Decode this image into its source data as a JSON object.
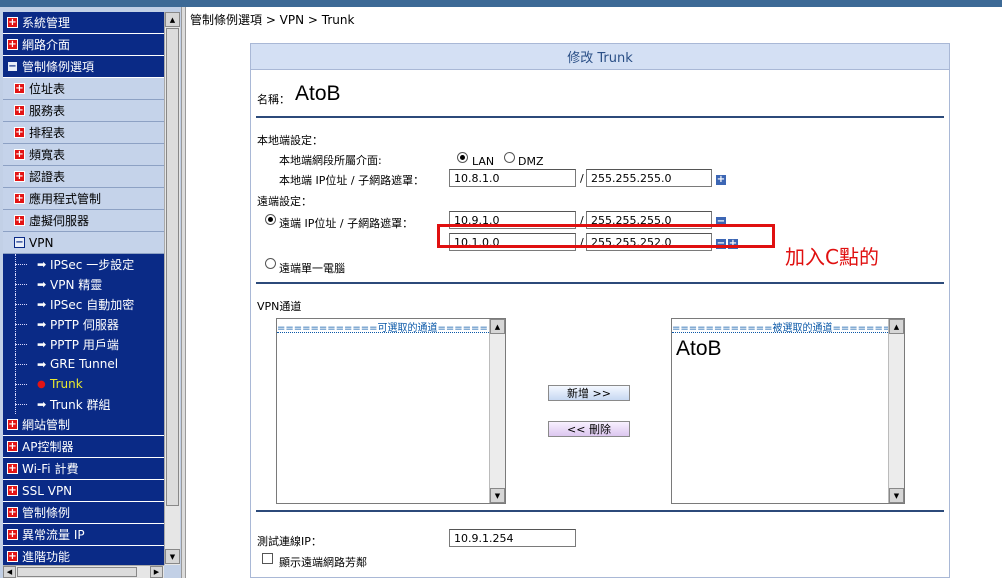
{
  "sidebar": {
    "items": [
      {
        "label": "系統管理",
        "type": "main",
        "icon": "plus-icon"
      },
      {
        "label": "網路介面",
        "type": "main",
        "icon": "plus-icon"
      },
      {
        "label": "管制條例選項",
        "type": "main",
        "icon": "minus-icon"
      },
      {
        "label": "位址表",
        "type": "sub",
        "icon": "plus-icon"
      },
      {
        "label": "服務表",
        "type": "sub",
        "icon": "plus-icon"
      },
      {
        "label": "排程表",
        "type": "sub",
        "icon": "plus-icon"
      },
      {
        "label": "頻寬表",
        "type": "sub",
        "icon": "plus-icon"
      },
      {
        "label": "認證表",
        "type": "sub",
        "icon": "plus-icon"
      },
      {
        "label": "應用程式管制",
        "type": "sub",
        "icon": "plus-icon"
      },
      {
        "label": "虛擬伺服器",
        "type": "sub",
        "icon": "plus-icon"
      },
      {
        "label": "VPN",
        "type": "sub",
        "icon": "minus-icon"
      },
      {
        "label": "IPSec 一步設定",
        "type": "leaf",
        "icon": "arrow-right-icon"
      },
      {
        "label": "VPN 精靈",
        "type": "leaf",
        "icon": "arrow-right-icon"
      },
      {
        "label": "IPSec 自動加密",
        "type": "leaf",
        "icon": "arrow-right-icon"
      },
      {
        "label": "PPTP 伺服器",
        "type": "leaf",
        "icon": "arrow-right-icon"
      },
      {
        "label": "PPTP 用戶端",
        "type": "leaf",
        "icon": "arrow-right-icon"
      },
      {
        "label": "GRE Tunnel",
        "type": "leaf",
        "icon": "arrow-right-icon"
      },
      {
        "label": "Trunk",
        "type": "leaf-active",
        "icon": "red-dot-icon"
      },
      {
        "label": "Trunk 群組",
        "type": "leaf",
        "icon": "arrow-right-icon"
      },
      {
        "label": "網站管制",
        "type": "main",
        "icon": "plus-icon"
      },
      {
        "label": "AP控制器",
        "type": "main",
        "icon": "plus-icon"
      },
      {
        "label": "Wi-Fi 計費",
        "type": "main",
        "icon": "plus-icon"
      },
      {
        "label": "SSL VPN",
        "type": "main",
        "icon": "plus-icon"
      },
      {
        "label": "管制條例",
        "type": "main",
        "icon": "plus-icon"
      },
      {
        "label": "異常流量 IP",
        "type": "main",
        "icon": "plus-icon"
      },
      {
        "label": "進階功能",
        "type": "main",
        "icon": "plus-icon"
      }
    ]
  },
  "breadcrumb": "管制條例選項 > VPN > Trunk",
  "panel": {
    "title": "修改 Trunk",
    "name_label": "名稱：",
    "name_value": "AtoB",
    "local_section": "本地端設定：",
    "local_iface_label": "本地端網段所屬介面:",
    "iface_lan": "LAN",
    "iface_dmz": "DMZ",
    "local_ip_label": "本地端 IP位址 / 子網路遮罩：",
    "local_ip": "10.8.1.0",
    "local_mask": "255.255.255.0",
    "remote_section": "遠端設定：",
    "remote_ip_label": "遠端 IP位址 / 子網路遮罩：",
    "remote_rows": [
      {
        "ip": "10.9.1.0",
        "mask": "255.255.255.0"
      },
      {
        "ip": "10.1.0.0",
        "mask": "255.255.252.0"
      }
    ],
    "remote_single_label": "遠端單一電腦",
    "slash": "/",
    "vpn_section": "VPN通道",
    "available_header": "============可選取的通道============",
    "selected_header": "============被選取的通道============",
    "selected_items": [
      "AtoB"
    ],
    "add_button": "新增 >>",
    "delete_button": "<< 刪除",
    "test_ip_label": "測試連線IP：",
    "test_ip": "10.9.1.254",
    "show_remote_label": "顯示遠端網路芳鄰"
  },
  "annotation": "加入C點的",
  "colors": {
    "nav_bg": "#0a2a86",
    "accent_red": "#e01010",
    "header_bg": "#d4e0f4"
  }
}
